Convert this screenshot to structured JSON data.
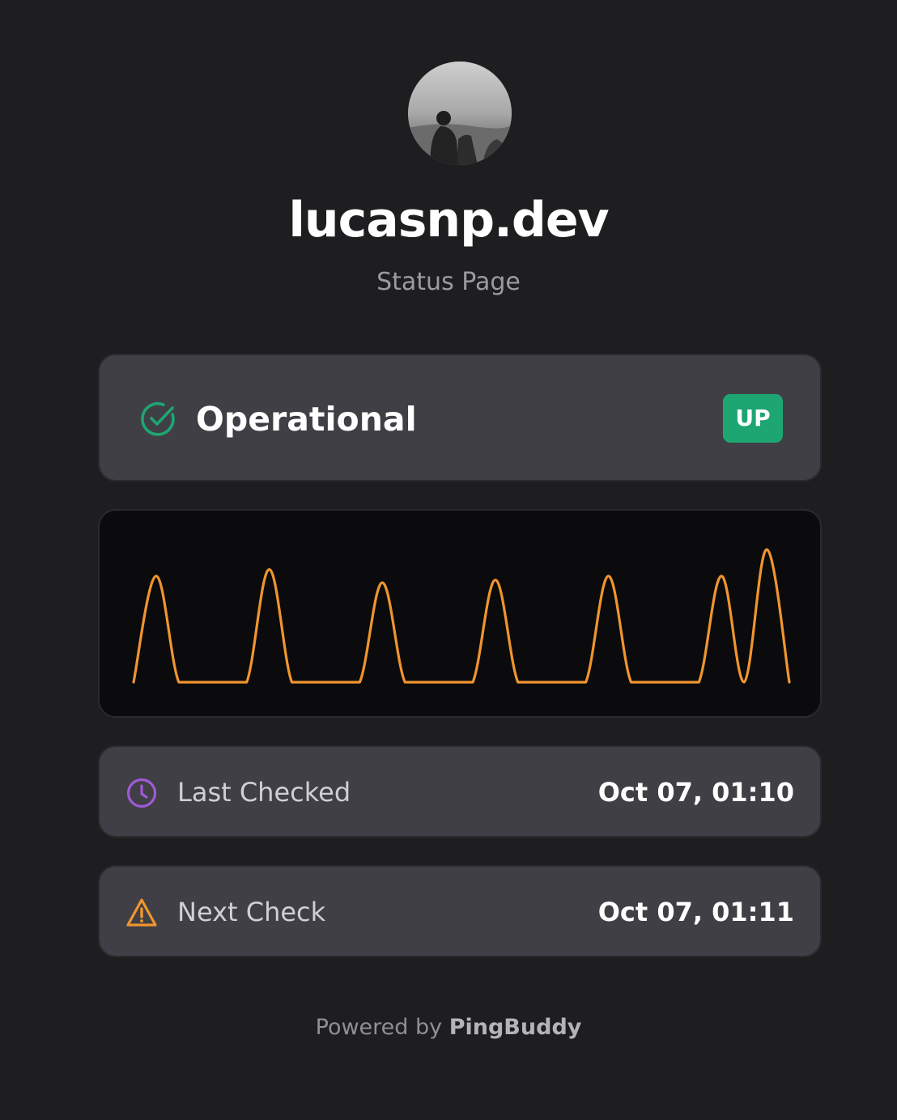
{
  "header": {
    "title": "lucasnp.dev",
    "subtitle": "Status Page"
  },
  "status": {
    "label": "Operational",
    "badge": "UP",
    "icon": "check-circle-icon",
    "color": "#1ea672"
  },
  "chart_data": {
    "type": "line",
    "color": "#f0952e",
    "grid": false,
    "legend": false,
    "y": [
      0,
      0.8,
      0,
      0,
      0,
      0,
      0.85,
      0,
      0,
      0,
      0,
      0.75,
      0,
      0,
      0,
      0,
      0.77,
      0,
      0,
      0,
      0,
      0.8,
      0,
      0,
      0,
      0,
      0.8,
      0,
      1.0,
      0
    ]
  },
  "last_checked": {
    "label": "Last Checked",
    "value": "Oct 07, 01:10",
    "icon": "clock-icon",
    "color": "#a05ad6"
  },
  "next_check": {
    "label": "Next Check",
    "value": "Oct 07, 01:11",
    "icon": "warning-icon",
    "color": "#f0952e"
  },
  "footer": {
    "prefix": "Powered by",
    "brand": "PingBuddy"
  }
}
